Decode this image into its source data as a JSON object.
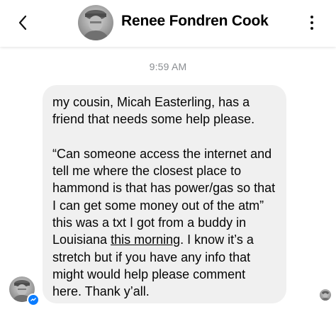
{
  "header": {
    "contact_name": "Renee Fondren Cook",
    "back_icon": "chevron-left-icon",
    "more_icon": "vertical-ellipsis-icon"
  },
  "thread": {
    "timestamp": "9:59 AM",
    "message": {
      "part1": "my cousin, Micah Easterling, has a friend that needs some help please.\n\n“Can someone access the internet and tell me where the closest place to hammond is that has power/gas so that I can get some money out of the atm” this was a txt I got from a buddy in Louisiana ",
      "link_text": "this morning",
      "part2": ". I know it’s a stretch but if you have any info that might would help please comment here. Thank y’all."
    }
  },
  "colors": {
    "bubble_bg": "#f0f0f0",
    "timestamp": "#8a8d91",
    "messenger_blue": "#0a7cff"
  }
}
